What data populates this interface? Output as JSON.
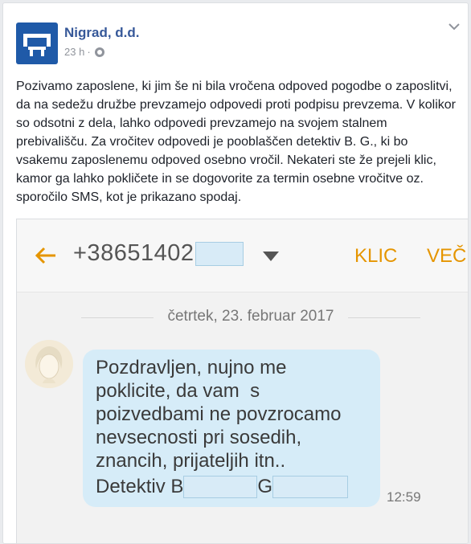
{
  "post": {
    "page_name": "Nigrad, d.d.",
    "time": "23 h",
    "separator": "·",
    "body": "Pozivamo zaposlene, ki jim še ni bila vročena odpoved pogodbe o zaposlitvi, da na sedežu družbe prevzamejo odpovedi proti podpisu prevzema. V kolikor so odsotni z dela, lahko odpovedi prevzamejo na svojem stalnem prebivališču. Za vročitev odpovedi je pooblaščen detektiv B. G., ki bo vsakemu zaposlenemu odpoved osebno vročil. Nekateri ste že prejeli klic, kamor ga lahko pokličete in se dogovorite za termin osebne vročitve oz. sporočilo SMS, kot je prikazano spodaj."
  },
  "sms": {
    "phone_prefix": "+38651402",
    "call_label": "KLIC",
    "more_label": "VEČ",
    "date": "četrtek, 23. februar 2017",
    "message_lines": "Pozdravljen, nujno me\npoklicite, da vam  s\npoizvedbami ne povzrocamo\nnevsecnosti pri sosedih,\nznancih, prijateljih itn..",
    "signature_prefix": "Detektiv B",
    "signature_mid": "G",
    "time": "12:59"
  },
  "colors": {
    "link": "#365899",
    "accent": "#e59500",
    "bubble": "#d6ecf8",
    "redaction": "#d8ebf7"
  },
  "icons": {
    "logo": "company-logo",
    "visibility": "globe-icon",
    "menu": "chevron-down-icon",
    "back": "back-arrow-icon",
    "dropdown": "caret-down-icon",
    "avatar": "contact-avatar"
  }
}
